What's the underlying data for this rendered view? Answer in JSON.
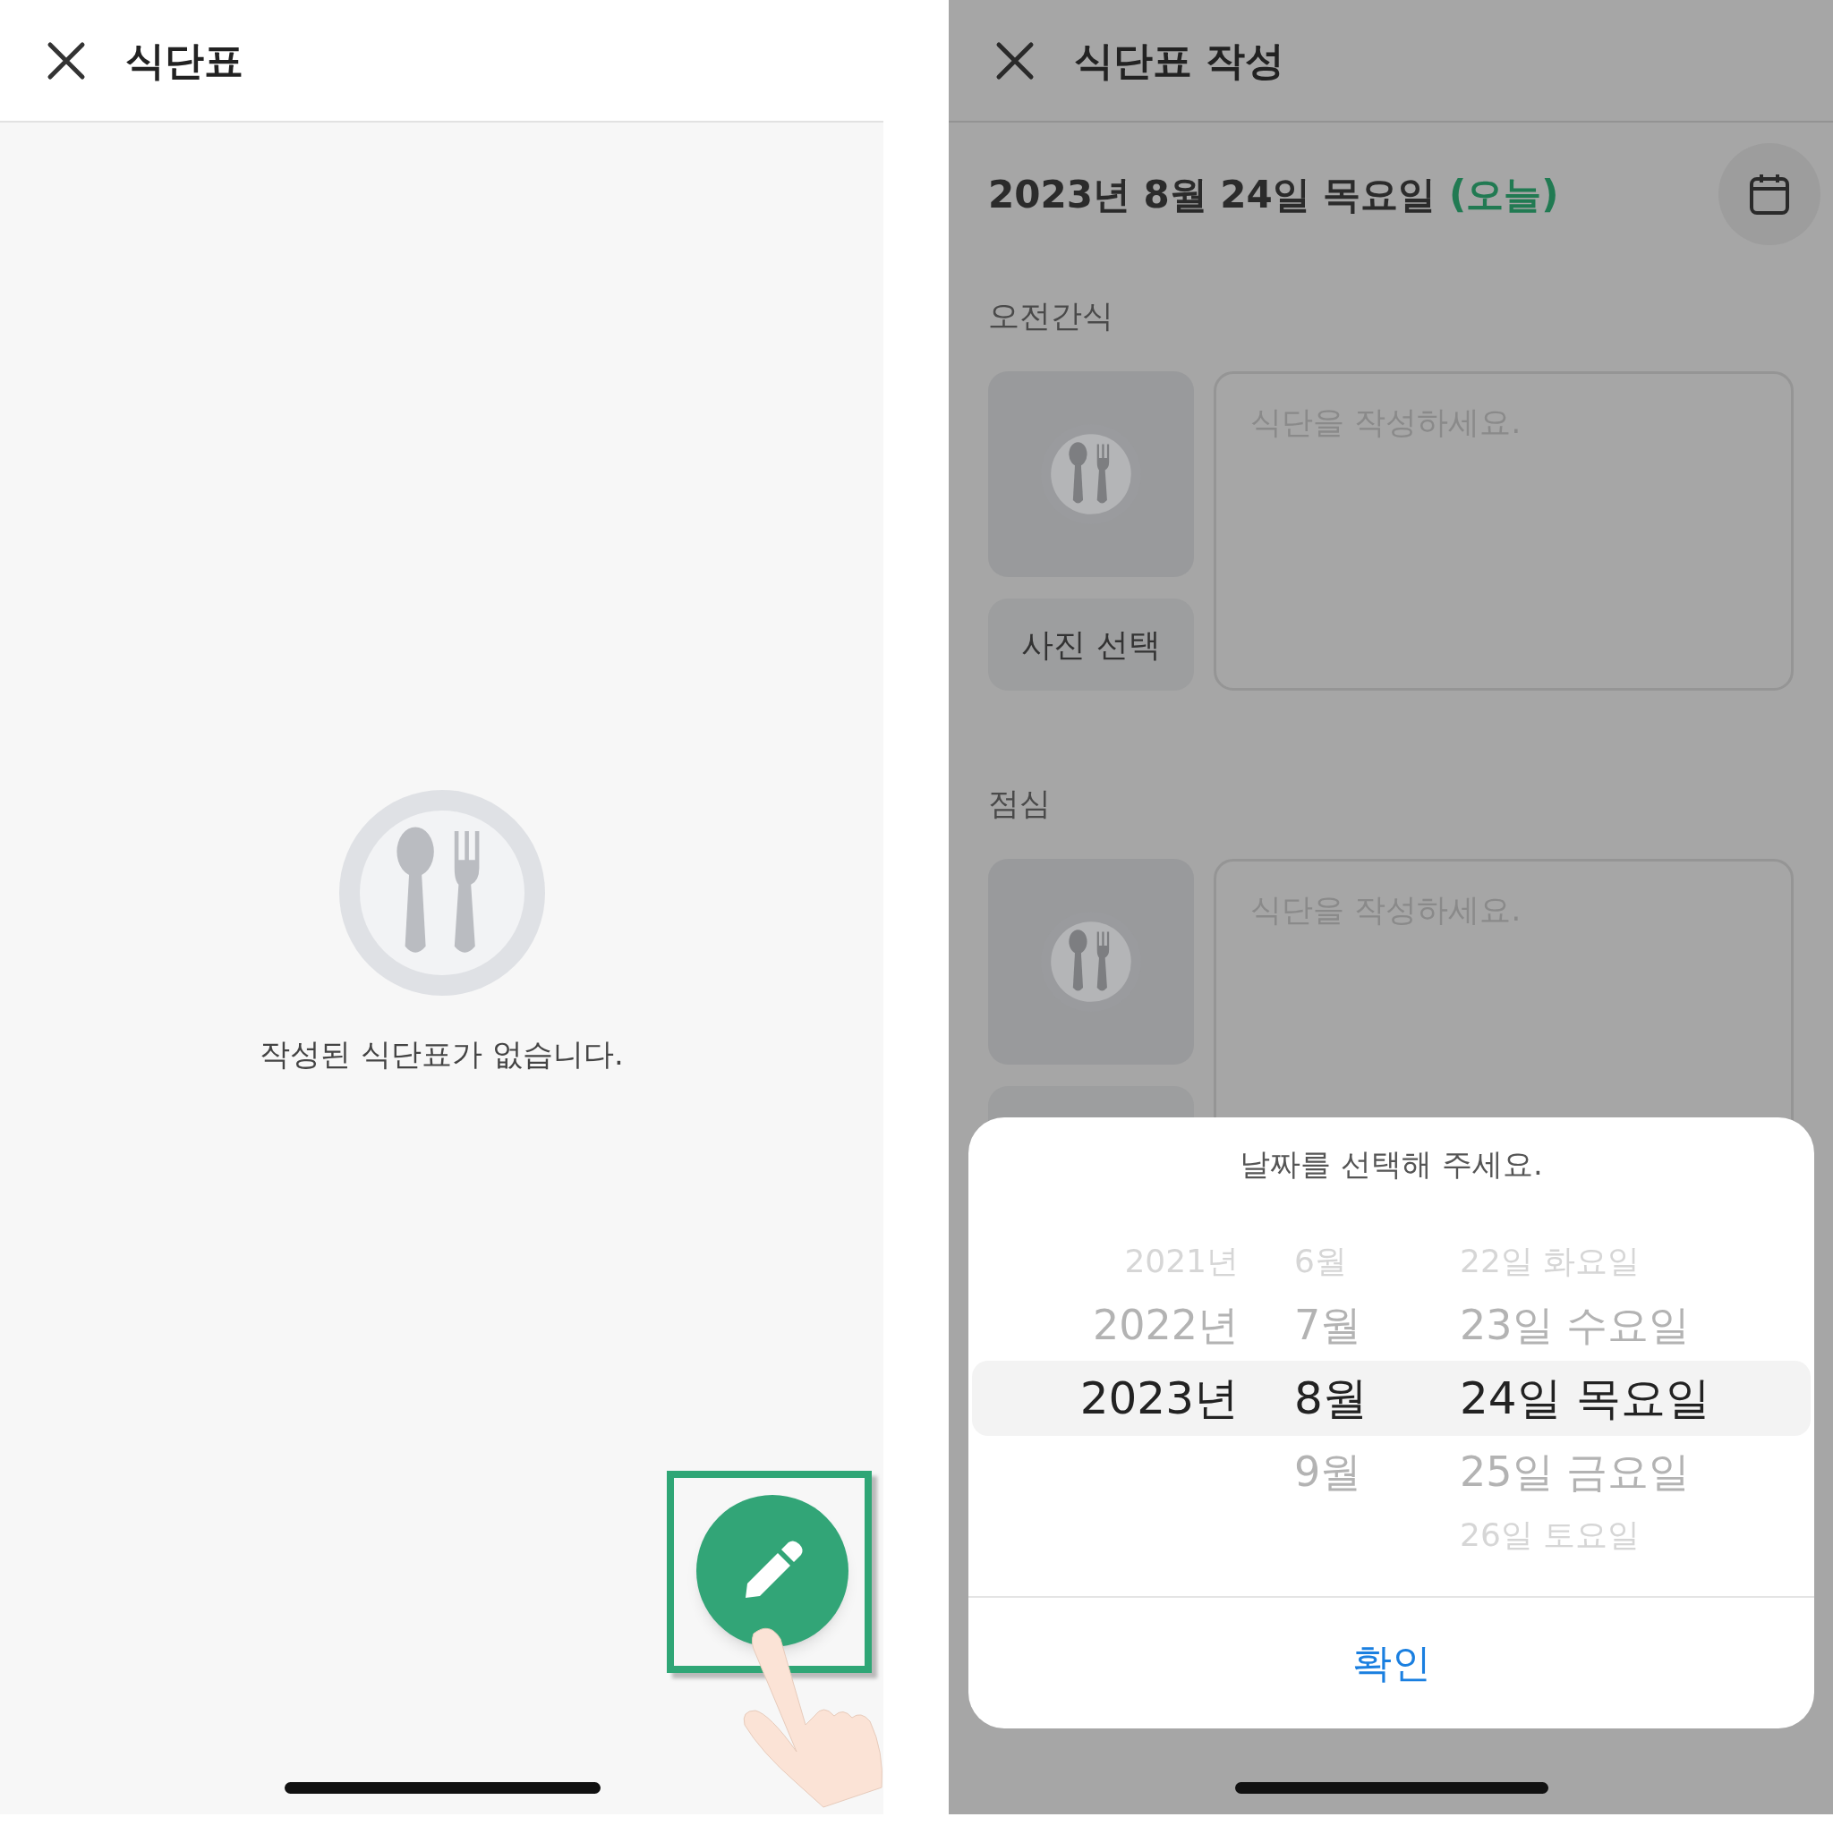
{
  "list_screen": {
    "title": "식단표",
    "empty_message": "작성된 식단표가 없습니다."
  },
  "edit_screen": {
    "title": "식단표 작성",
    "date": "2023년 8월 24일 목요일",
    "today_label": "(오늘)",
    "meals": [
      {
        "label": "오전간식",
        "placeholder": "식단을 작성하세요.",
        "photo_button": "사진 선택"
      },
      {
        "label": "점심",
        "placeholder": "식단을 작성하세요."
      }
    ]
  },
  "date_sheet": {
    "title": "날짜를 선택해 주세요.",
    "confirm": "확인",
    "rows": [
      {
        "year": "2021년",
        "month": "6월",
        "day": "22일 화요일",
        "selected": false
      },
      {
        "year": "2022년",
        "month": "7월",
        "day": "23일 수요일",
        "selected": false
      },
      {
        "year": "2023년",
        "month": "8월",
        "day": "24일 목요일",
        "selected": true
      },
      {
        "month": "9월",
        "day": "25일 금요일",
        "selected": false
      },
      {
        "day": "26일 토요일",
        "selected": false
      }
    ]
  }
}
